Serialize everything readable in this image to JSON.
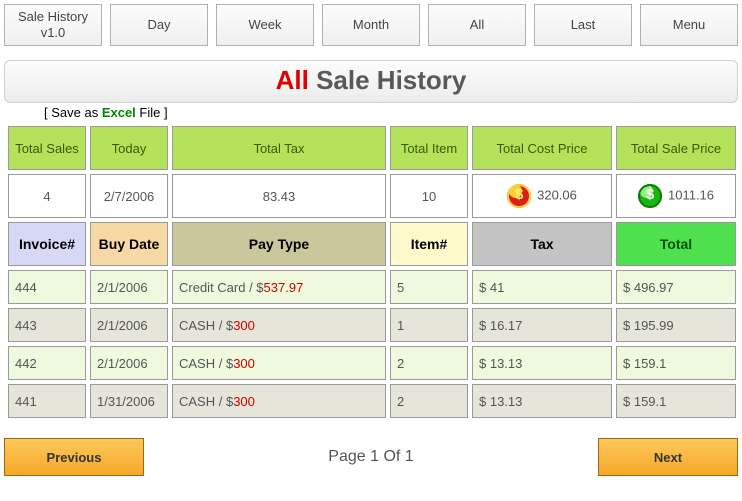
{
  "topbar": {
    "version": "Sale History\nv1.0",
    "day": "Day",
    "week": "Week",
    "month": "Month",
    "all": "All",
    "last": "Last",
    "menu": "Menu"
  },
  "title": {
    "word1": "All",
    "word2": " Sale History"
  },
  "save_link": {
    "pre": "[ Save as ",
    "excel": "Excel",
    "post": " File ]"
  },
  "summary_headers": {
    "total_sales": "Total Sales",
    "today": "Today",
    "total_tax": "Total Tax",
    "total_item": "Total Item",
    "total_cost_price": "Total Cost Price",
    "total_sale_price": "Total Sale Price"
  },
  "summary_values": {
    "total_sales": "4",
    "today": "2/7/2006",
    "total_tax": "83.43",
    "total_item": "10",
    "total_cost_price": "320.06",
    "total_sale_price": "1011.16"
  },
  "column_headers": {
    "invoice": "Invoice#",
    "buy_date": "Buy Date",
    "pay_type": "Pay Type",
    "item": "Item#",
    "tax": "Tax",
    "total": "Total"
  },
  "rows": [
    {
      "invoice": "444",
      "buy_date": "2/1/2006",
      "pay_type_prefix": "Credit Card / $",
      "pay_type_amount": "537.97",
      "item": "5",
      "tax": "$ 41",
      "total": "$ 496.97"
    },
    {
      "invoice": "443",
      "buy_date": "2/1/2006",
      "pay_type_prefix": "CASH / $",
      "pay_type_amount": "300",
      "item": "1",
      "tax": "$ 16.17",
      "total": "$ 195.99"
    },
    {
      "invoice": "442",
      "buy_date": "2/1/2006",
      "pay_type_prefix": "CASH / $",
      "pay_type_amount": "300",
      "item": "2",
      "tax": "$ 13.13",
      "total": "$ 159.1"
    },
    {
      "invoice": "441",
      "buy_date": "1/31/2006",
      "pay_type_prefix": "CASH / $",
      "pay_type_amount": "300",
      "item": "2",
      "tax": "$ 13.13",
      "total": "$ 159.1"
    }
  ],
  "footer": {
    "previous": "Previous",
    "next": "Next",
    "page_info": "Page 1 Of 1"
  }
}
